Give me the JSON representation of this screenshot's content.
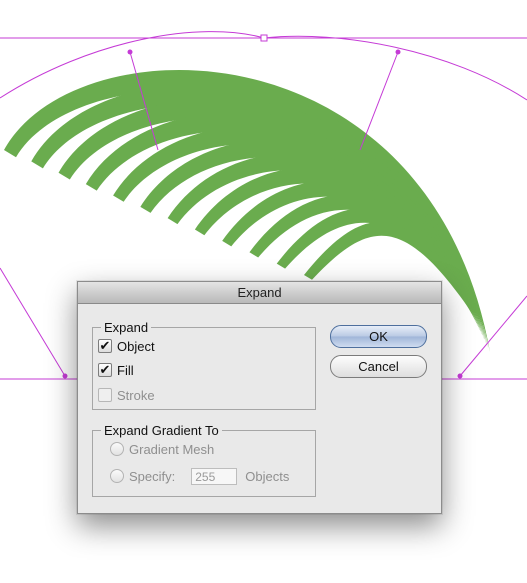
{
  "dialog": {
    "title": "Expand",
    "expand_group": {
      "legend": "Expand",
      "object": {
        "label": "Object",
        "checked": true
      },
      "fill": {
        "label": "Fill",
        "checked": true
      },
      "stroke": {
        "label": "Stroke",
        "checked": false,
        "enabled": false
      }
    },
    "gradient_group": {
      "legend": "Expand Gradient To",
      "gradient_mesh": {
        "label": "Gradient Mesh"
      },
      "specify": {
        "label": "Specify:",
        "value": "255",
        "units": "Objects"
      }
    },
    "buttons": {
      "ok": "OK",
      "cancel": "Cancel"
    }
  },
  "colors": {
    "artwork_green": "#6aac4e",
    "selection_magenta": "#c53bd6"
  }
}
